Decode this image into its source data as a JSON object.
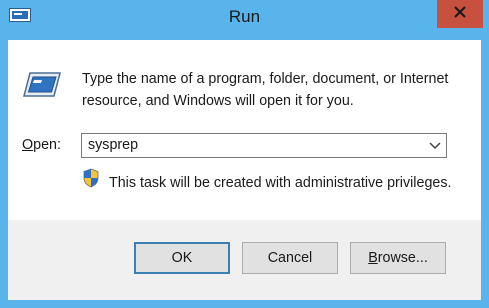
{
  "window": {
    "title": "Run",
    "icon": "run-app-icon",
    "close_icon": "close-icon"
  },
  "dialog": {
    "description": "Type the name of a program, folder, document, or Internet resource, and Windows will open it for you.",
    "open_label_accel": "O",
    "open_label_rest": "pen:",
    "open_value": "sysprep",
    "admin_note": "This task will be created with administrative privileges."
  },
  "buttons": {
    "ok": "OK",
    "cancel": "Cancel",
    "browse_accel": "B",
    "browse_rest": "rowse..."
  },
  "colors": {
    "title_bar": "#5ab4ec",
    "close_button": "#c7503f",
    "footer": "#f0f0f0",
    "button_face": "#e1e1e1",
    "default_button_border": "#3c7fb1"
  }
}
